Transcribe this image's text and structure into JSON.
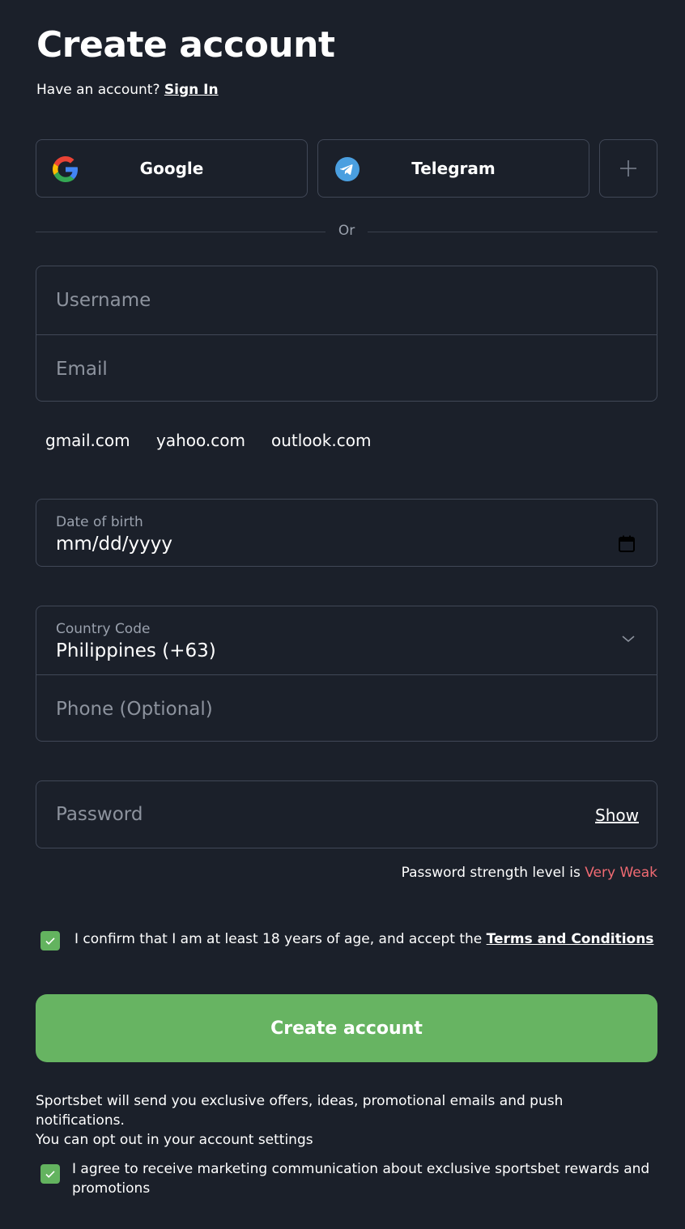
{
  "header": {
    "title": "Create account",
    "have_account_text": "Have an account? ",
    "sign_in_label": "Sign In"
  },
  "social": {
    "google_label": "Google",
    "telegram_label": "Telegram",
    "more_icon": "plus-icon"
  },
  "divider": {
    "text": "Or"
  },
  "form": {
    "username_placeholder": "Username",
    "email_placeholder": "Email",
    "email_suggestions": [
      "gmail.com",
      "yahoo.com",
      "outlook.com"
    ],
    "dob_label": "Date of birth",
    "dob_value": "mm/dd/yyyy",
    "country_label": "Country Code",
    "country_value": "Philippines (+63)",
    "phone_placeholder": "Phone (Optional)",
    "password_placeholder": "Password",
    "show_label": "Show",
    "strength_prefix": "Password strength level is ",
    "strength_value": "Very Weak"
  },
  "terms": {
    "text": "I confirm that I am at least 18 years of age, and accept the ",
    "link": "Terms and Conditions",
    "checked": true
  },
  "submit": {
    "label": "Create account"
  },
  "marketing": {
    "info_line1": "Sportsbet will send you exclusive offers, ideas, promotional emails and push notifications.",
    "info_line2": "You can opt out in your account settings",
    "agree_text": "I agree to receive marketing communication about exclusive sportsbet rewards and promotions",
    "checked": true
  },
  "colors": {
    "background": "#1b202a",
    "accent_green": "#67b462",
    "weak_red": "#f06a72",
    "border": "#414857"
  }
}
